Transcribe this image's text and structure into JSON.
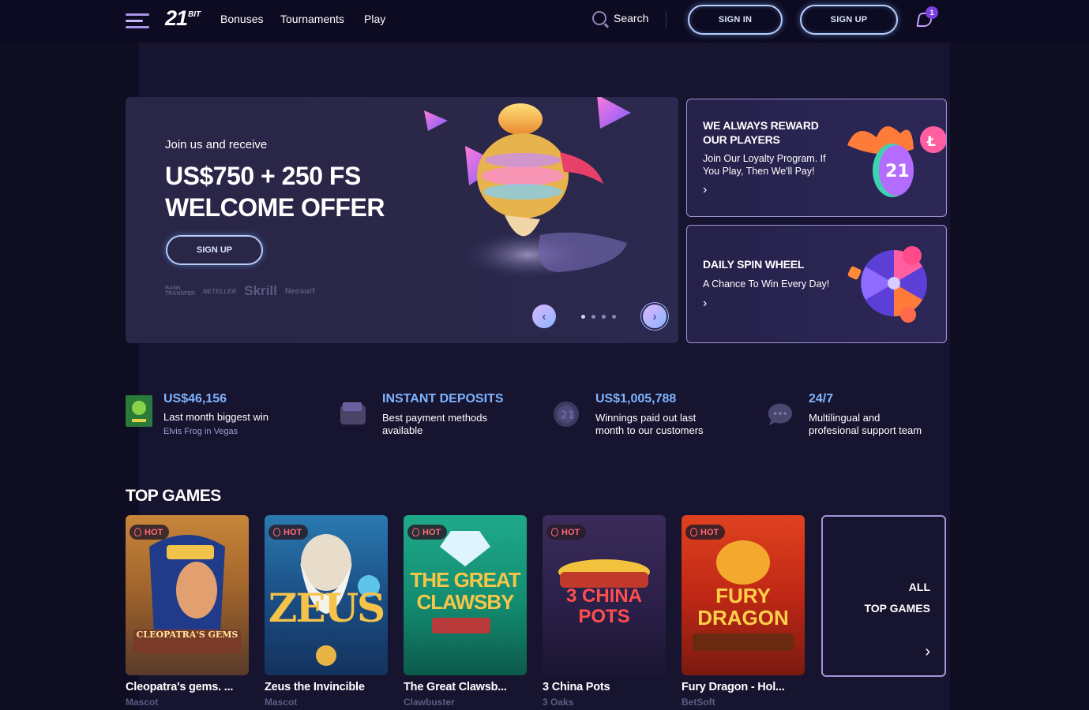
{
  "header": {
    "logo": "21",
    "logo_suffix": "BIT",
    "nav": [
      "Bonuses",
      "Tournaments",
      "Play"
    ],
    "search_label": "Search",
    "sign_in": "SIGN IN",
    "sign_up": "SIGN UP",
    "notification_count": "1"
  },
  "hero": {
    "subtitle": "Join us and receive",
    "title_line1": "US$750 + 250 FS",
    "title_line2": "WELCOME OFFER",
    "cta": "SIGN UP",
    "payment_logos": [
      "BANK TRANSFER",
      "NETELLER",
      "Skrill",
      "Neosurf"
    ],
    "slides": 4,
    "active_slide": 0
  },
  "promos": [
    {
      "title_line1": "WE ALWAYS REWARD",
      "title_line2": "OUR PLAYERS",
      "text_line1": "Join Our Loyalty Program. If",
      "text_line2": "You Play, Then We'll Pay!",
      "arrow": "›"
    },
    {
      "title_line1": "DAILY SPIN WHEEL",
      "text_line1": "A Chance To Win Every Day!",
      "arrow": "›"
    }
  ],
  "stats": [
    {
      "value": "US$46,156",
      "value_color": "#7fb4ff",
      "desc_line1": "Last month biggest win",
      "link": "Elvis Frog in Vegas"
    },
    {
      "value": "INSTANT DEPOSITS",
      "value_color": "#7fb4ff",
      "desc_line1": "Best payment methods",
      "desc_line2": "available"
    },
    {
      "value": "US$1,005,788",
      "value_color": "#7fb4ff",
      "desc_line1": "Winnings paid out last",
      "desc_line2": "month to our customers"
    },
    {
      "value": "24/7",
      "value_color": "#7fb4ff",
      "desc_line1": "Multilingual and",
      "desc_line2": "profesional support team"
    }
  ],
  "top_games": {
    "title": "TOP GAMES",
    "badge": "HOT",
    "games": [
      {
        "name": "Cleopatra's gems. ...",
        "provider": "Mascot",
        "art": "CLEOPATRA'S GEMS"
      },
      {
        "name": "Zeus the Invincible",
        "provider": "Mascot",
        "art": "ZEUS"
      },
      {
        "name": "The Great Clawsb...",
        "provider": "Clawbuster",
        "art": "THE GREAT CLAWSBY"
      },
      {
        "name": "3 China Pots",
        "provider": "3 Oaks",
        "art": "3 CHINA POTS"
      },
      {
        "name": "Fury Dragon - Hol...",
        "provider": "BetSoft",
        "art": "FURY DRAGON"
      }
    ],
    "all_line1": "ALL",
    "all_line2": "TOP GAMES",
    "all_arrow": "›"
  },
  "colors": {
    "background": "#14112a",
    "accent_blue": "#7fb4ff",
    "border_purple": "#9f95d6",
    "hot_red": "#ff6b7a"
  }
}
